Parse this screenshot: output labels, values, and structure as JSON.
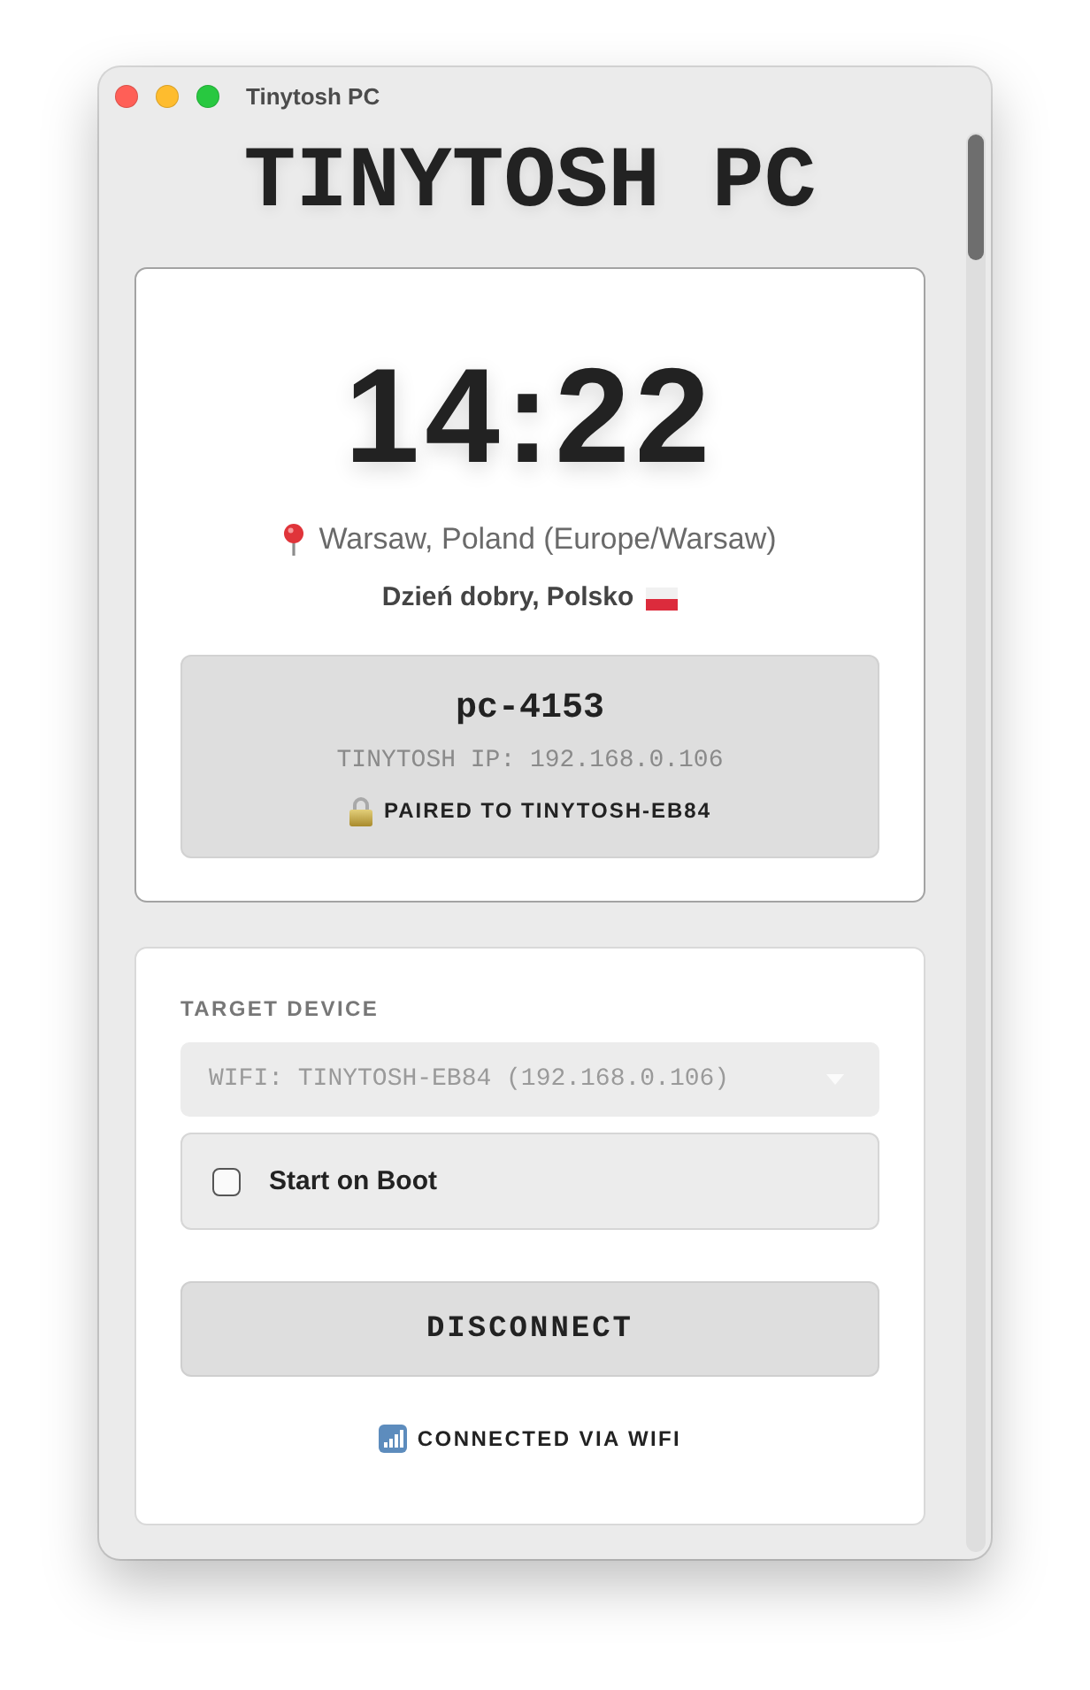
{
  "window": {
    "title": "Tinytosh PC"
  },
  "app_title": "TINYTOSH PC",
  "clock": {
    "time": "14:22",
    "location": "Warsaw, Poland (Europe/Warsaw)",
    "greeting": "Dzień dobry, Polsko"
  },
  "device": {
    "name": "pc-4153",
    "ip": "TINYTOSH IP: 192.168.0.106",
    "pairing": "PAIRED TO TINYTOSH-EB84"
  },
  "settings": {
    "target_label": "TARGET DEVICE",
    "target": {
      "value": "WIFI: TINYTOSH-EB84 (192.168.0.106)",
      "disabled": true
    },
    "start_on_boot": {
      "label": "Start on Boot",
      "checked": false
    },
    "action": "DISCONNECT",
    "status": "CONNECTED VIA WIFI"
  }
}
